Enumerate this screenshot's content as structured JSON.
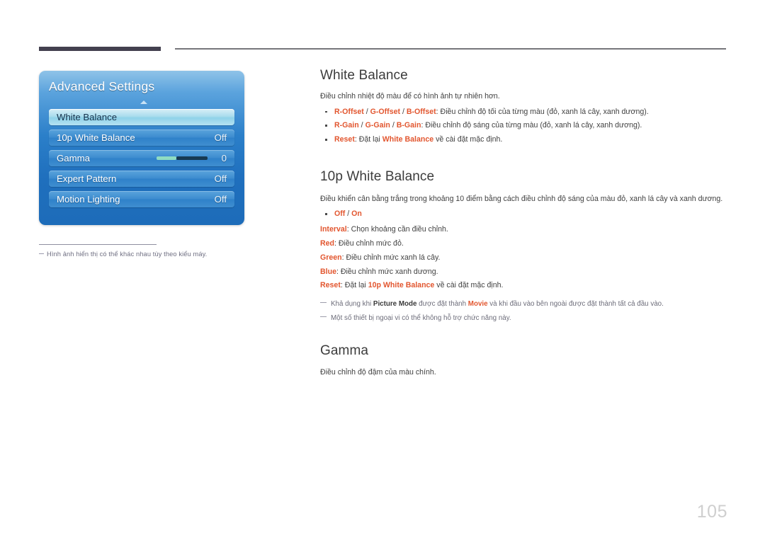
{
  "header": {
    "rule_thick_color": "#43404f",
    "rule_thin_color": "#76767b"
  },
  "osd_panel": {
    "title": "Advanced Settings",
    "caret_icon": "caret-up-icon",
    "rows": [
      {
        "label": "White Balance",
        "value": "",
        "selected": true,
        "has_slider": false
      },
      {
        "label": "10p White Balance",
        "value": "Off",
        "selected": false,
        "has_slider": false
      },
      {
        "label": "Gamma",
        "value": "0",
        "selected": false,
        "has_slider": true
      },
      {
        "label": "Expert Pattern",
        "value": "Off",
        "selected": false,
        "has_slider": false
      },
      {
        "label": "Motion Lighting",
        "value": "Off",
        "selected": false,
        "has_slider": false
      }
    ],
    "accent_blue": "#2b7fc9",
    "selected_row_color": "#a9dced"
  },
  "caption": {
    "note": "Hình ảnh hiển thị có thể khác nhau tùy theo kiểu máy."
  },
  "sections": {
    "white_balance": {
      "title": "White Balance",
      "intro": "Điều chỉnh nhiệt độ màu để có hình ảnh tự nhiên hơn.",
      "bullets": [
        {
          "terms": [
            "R-Offset",
            "G-Offset",
            "B-Offset"
          ],
          "separator": " / ",
          "text": ": Điều chỉnh độ tối của từng màu (đỏ, xanh lá cây, xanh dương)."
        },
        {
          "terms": [
            "R-Gain",
            "G-Gain",
            "B-Gain"
          ],
          "separator": " / ",
          "text": ": Điều chỉnh độ sáng của từng màu (đỏ, xanh lá cây, xanh dương)."
        },
        {
          "terms": [
            "Reset"
          ],
          "separator": "",
          "text_before": ": Đặt lại ",
          "inline_term": "White Balance",
          "text_after": " về cài đặt mặc định."
        }
      ]
    },
    "ten_p_white_balance": {
      "title": "10p White Balance",
      "intro": "Điều khiển cân bằng trắng trong khoảng 10 điểm bằng cách điều chỉnh độ sáng của màu đỏ, xanh lá cây và xanh dương.",
      "bullet_off_on": {
        "off": "Off",
        "sep": " / ",
        "on": "On"
      },
      "items": [
        {
          "term": "Interval",
          "text": ": Chọn khoảng cần điều chỉnh."
        },
        {
          "term": "Red",
          "text": ": Điều chỉnh mức đỏ."
        },
        {
          "term": "Green",
          "text": ": Điều chỉnh mức xanh lá cây."
        },
        {
          "term": "Blue",
          "text": ": Điều chỉnh mức xanh dương."
        }
      ],
      "reset_item": {
        "term": "Reset",
        "text_before": ": Đặt lại ",
        "inline_term": "10p White Balance",
        "text_after": " về cài đặt mặc định."
      },
      "footnotes": [
        {
          "p1": "Khả dụng khi ",
          "b1": "Picture Mode",
          "p2": " được đặt thành ",
          "b2": "Movie",
          "p3": " và khi đầu vào bên ngoài được đặt thành tất cả đầu vào."
        },
        {
          "p1": "Một số thiết bị ngoại vi có thể không hỗ trợ chức năng này.",
          "b1": "",
          "p2": "",
          "b2": "",
          "p3": ""
        }
      ]
    },
    "gamma": {
      "title": "Gamma",
      "intro": "Điều chỉnh độ đậm của màu chính."
    }
  },
  "page_number": "105",
  "accent_color": "#e2562f"
}
